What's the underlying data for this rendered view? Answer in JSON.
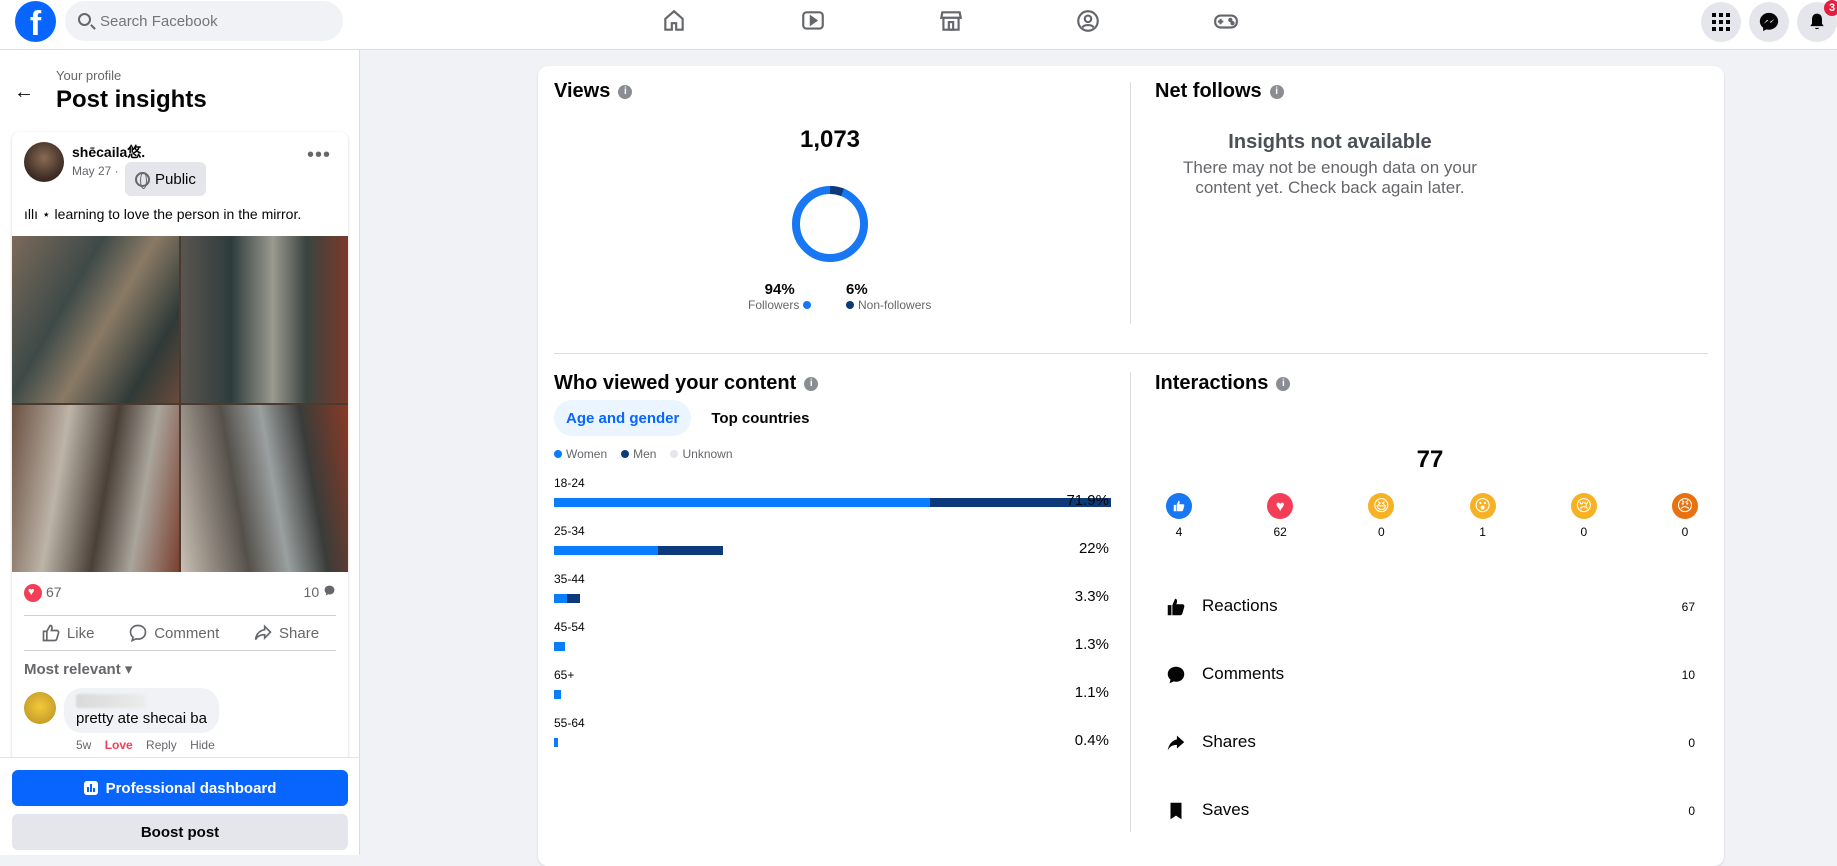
{
  "topbar": {
    "logo": "f",
    "search_placeholder": "Search Facebook",
    "notification_count": "3"
  },
  "left": {
    "crumb": "Your profile",
    "title": "Post insights",
    "post": {
      "author": "shēcaila悠.",
      "date": "May 27 ·",
      "privacy": "Public",
      "text": "ıllı ⋆ learning to love the person in the mirror.",
      "reaction_count": "67",
      "comment_count": "10",
      "actions": {
        "like": "Like",
        "comment": "Comment",
        "share": "Share"
      },
      "sort_label": "Most relevant",
      "comment": {
        "text": "pretty ate shecai ba",
        "age": "5w",
        "love": "Love",
        "reply": "Reply",
        "hide": "Hide"
      }
    },
    "buttons": {
      "dashboard": "Professional dashboard",
      "boost": "Boost post"
    }
  },
  "views": {
    "title": "Views",
    "total": "1,073",
    "followers_pct": "94%",
    "followers_label": "Followers",
    "nonfollowers_pct": "6%",
    "nonfollowers_label": "Non-followers",
    "followers_fraction": 0.94
  },
  "net_follows": {
    "title": "Net follows",
    "na_title": "Insights not available",
    "na_text": "There may not be enough data on your content yet. Check back again later."
  },
  "who_viewed": {
    "title": "Who viewed your content",
    "tabs": [
      "Age and gender",
      "Top countries"
    ],
    "legend": [
      "Women",
      "Men",
      "Unknown"
    ],
    "rows": [
      {
        "age": "18-24",
        "pct": "71.9%",
        "women": 0.677,
        "men": 0.327
      },
      {
        "age": "25-34",
        "pct": "22%",
        "women": 0.187,
        "men": 0.117
      },
      {
        "age": "35-44",
        "pct": "3.3%",
        "women": 0.023,
        "men": 0.023
      },
      {
        "age": "45-54",
        "pct": "1.3%",
        "women": 0.02,
        "men": 0.0
      },
      {
        "age": "65+",
        "pct": "1.1%",
        "women": 0.013,
        "men": 0.0
      },
      {
        "age": "55-64",
        "pct": "0.4%",
        "women": 0.007,
        "men": 0.0
      }
    ]
  },
  "interactions": {
    "title": "Interactions",
    "total": "77",
    "reactions": [
      {
        "icon": "like-reaction-icon",
        "count": "4",
        "color": "#1877f2"
      },
      {
        "icon": "love-reaction-icon",
        "count": "62",
        "color": "#f33e58"
      },
      {
        "icon": "haha-reaction-icon",
        "count": "0",
        "color": "#f7b125"
      },
      {
        "icon": "wow-reaction-icon",
        "count": "1",
        "color": "#f7b125"
      },
      {
        "icon": "sad-reaction-icon",
        "count": "0",
        "color": "#f7b125"
      },
      {
        "icon": "angry-reaction-icon",
        "count": "0",
        "color": "#e9710f"
      }
    ],
    "metrics": [
      {
        "label": "Reactions",
        "value": "67"
      },
      {
        "label": "Comments",
        "value": "10"
      },
      {
        "label": "Shares",
        "value": "0"
      },
      {
        "label": "Saves",
        "value": "0"
      }
    ]
  },
  "colors": {
    "accent": "#0866ff",
    "women": "#0a7cff",
    "men": "#0d3a7a",
    "unknown": "#e4e6eb"
  }
}
